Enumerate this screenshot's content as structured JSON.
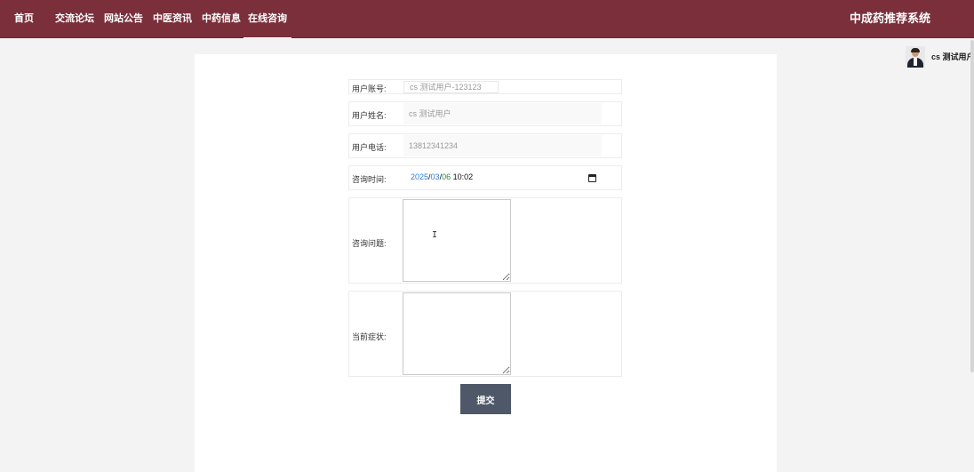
{
  "nav": {
    "items": [
      {
        "label": "首页"
      },
      {
        "label": "交流论坛"
      },
      {
        "label": "网站公告"
      },
      {
        "label": "中医资讯"
      },
      {
        "label": "中药信息"
      },
      {
        "label": "在线咨询"
      }
    ],
    "active_index": 5
  },
  "brand": {
    "title": "中成药推荐系统"
  },
  "user": {
    "name": "cs 测试用户"
  },
  "form": {
    "account": {
      "label": "用户账号:",
      "value": "cs 测试用户-123123"
    },
    "name": {
      "label": "用户姓名:",
      "value": "cs 测试用户"
    },
    "phone": {
      "label": "用户电话:",
      "value": "13812341234"
    },
    "time": {
      "label": "咨询时间:",
      "year": "2025",
      "month": "03",
      "day": "06",
      "clock": "10:02",
      "sep": "/"
    },
    "question": {
      "label": "咨询问题:",
      "value": ""
    },
    "symptom": {
      "label": "当前症状:",
      "value": ""
    },
    "submit_label": "提交"
  },
  "colors": {
    "header": "#7a2f3b",
    "button": "#4e5868"
  }
}
